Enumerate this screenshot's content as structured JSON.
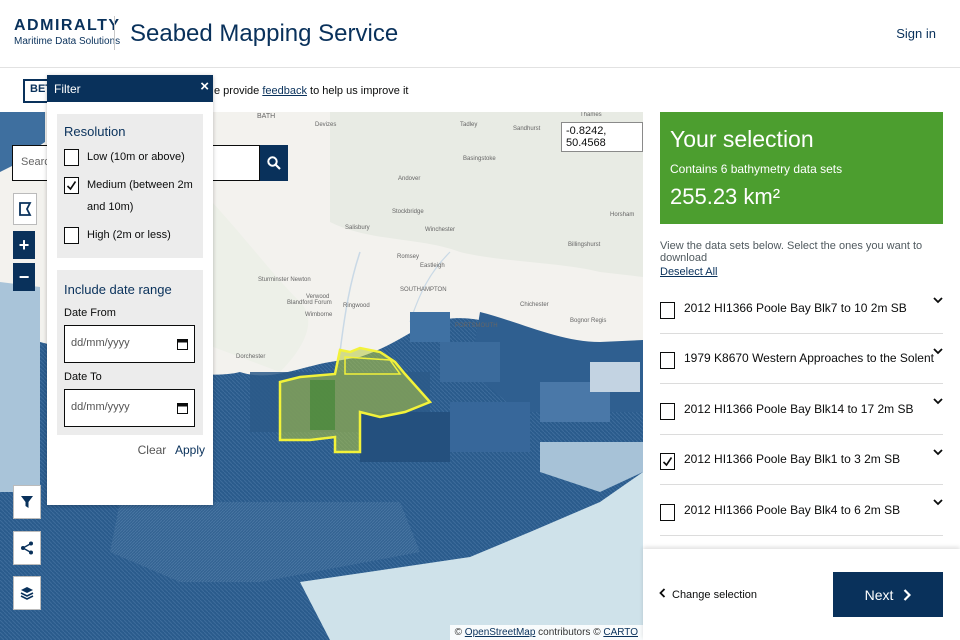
{
  "header": {
    "brand_name": "ADMIRALTY",
    "brand_sub": "Maritime Data Solutions",
    "service_title": "Seabed Mapping Service",
    "signin": "Sign in"
  },
  "beta": {
    "tag": "BETA",
    "text_before": "e provide ",
    "link": "feedback",
    "text_after": " to help us improve it"
  },
  "search": {
    "placeholder": "Search"
  },
  "map": {
    "coordinate": "-0.8242, 50.4568",
    "attribution_prefix": "© ",
    "osm": "OpenStreetMap",
    "contributors": " contributors © ",
    "carto": "CARTO",
    "labels": [
      "BATH",
      "Devizes",
      "Tadley",
      "Sandhurst",
      "Thames",
      "Basingstoke",
      "Andover",
      "Salisbury",
      "Winchester",
      "Stockbridge",
      "Romsey",
      "Eastleigh",
      "SOUTHAMPTON",
      "PORTSMOUTH",
      "Chichester",
      "Billingshurst",
      "Horsham",
      "Wimborne",
      "Verwood",
      "Ringwood",
      "Blandford Forum",
      "Sturminster Newton",
      "Dorchester",
      "Bognor Regis"
    ],
    "zoom_in": "+",
    "zoom_out": "−"
  },
  "filter": {
    "title": "Filter",
    "close": "×",
    "resolution_title": "Resolution",
    "options": [
      {
        "label": "Low (10m or above)",
        "checked": false
      },
      {
        "label": "Medium (between 2m and 10m)",
        "checked": true
      },
      {
        "label": "High (2m or less)",
        "checked": false
      }
    ],
    "date_title": "Include date range",
    "date_from": "Date From",
    "date_to": "Date To",
    "date_placeholder": "dd/mm/yyyy",
    "clear": "Clear",
    "apply": "Apply"
  },
  "selection": {
    "title": "Your selection",
    "count": "Contains 6 bathymetry data sets",
    "area": "255.23 km²",
    "hint": "View the data sets below. Select the ones you want to download",
    "deselect": "Deselect All",
    "items": [
      {
        "label": "2012 HI1366 Poole Bay Blk7 to 10 2m SB",
        "checked": false
      },
      {
        "label": "1979 K8670 Western Approaches to the Solent",
        "checked": false
      },
      {
        "label": "2012 HI1366 Poole Bay Blk14 to 17 2m SB",
        "checked": false
      },
      {
        "label": "2012 HI1366 Poole Bay Blk1 to 3 2m SB",
        "checked": true
      },
      {
        "label": "2012 HI1366 Poole Bay Blk4 to 6 2m SB",
        "checked": false
      }
    ],
    "change": "Change selection",
    "next": "Next"
  },
  "colors": {
    "navy": "#09315b",
    "selection_green": "#4c9e2f",
    "sea_deep": "#1f4e7f",
    "sea_mid": "#4a78a8",
    "highlight_yellow": "#f2f23a"
  }
}
